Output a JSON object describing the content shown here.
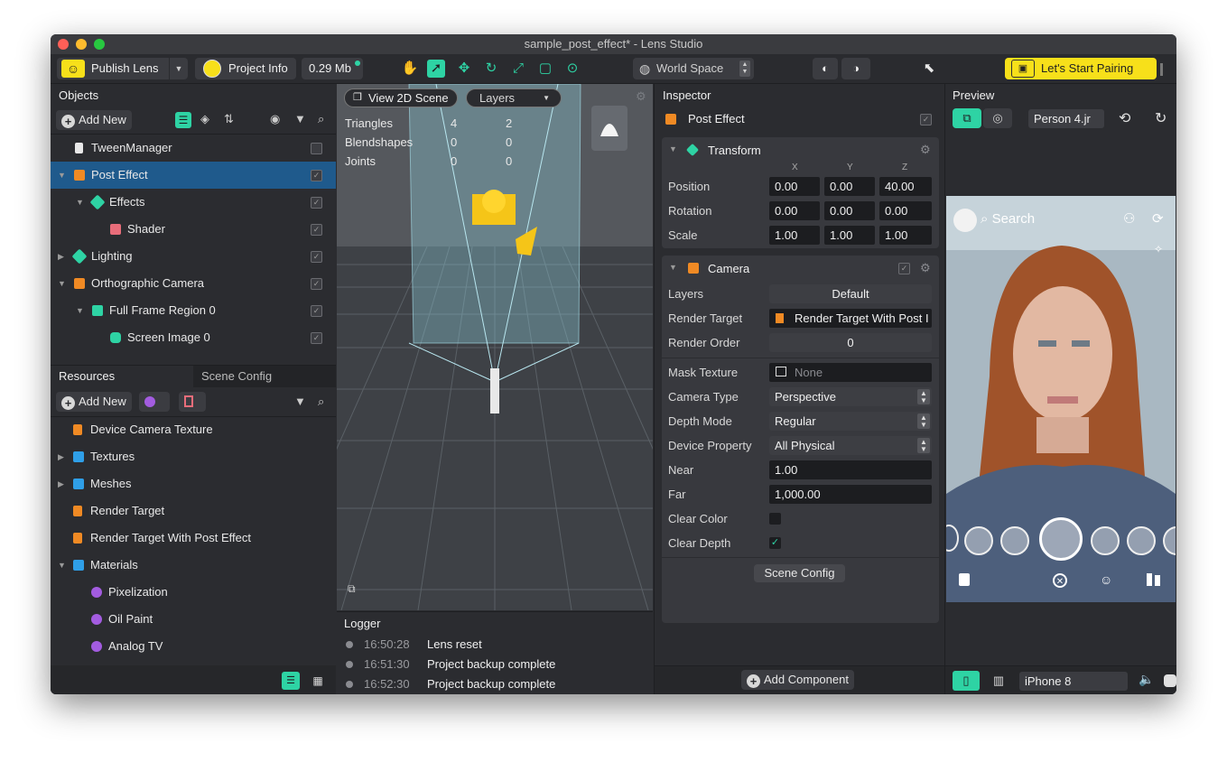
{
  "window": {
    "title": "sample_post_effect* - Lens Studio"
  },
  "toolbar": {
    "publish_label": "Publish Lens",
    "project_info_label": "Project Info",
    "size_label": "0.29 Mb",
    "space_label": "World Space",
    "pairing_label": "Let's Start Pairing"
  },
  "objects": {
    "title": "Objects",
    "add_new": "Add New",
    "items": [
      {
        "label": "TweenManager"
      },
      {
        "label": "Post Effect"
      },
      {
        "label": "Effects"
      },
      {
        "label": "Shader"
      },
      {
        "label": "Lighting"
      },
      {
        "label": "Orthographic Camera"
      },
      {
        "label": "Full Frame Region 0"
      },
      {
        "label": "Screen Image 0"
      }
    ]
  },
  "resources": {
    "tab_resources": "Resources",
    "tab_scene_config": "Scene Config",
    "add_new": "Add New",
    "items": [
      {
        "label": "Device Camera Texture"
      },
      {
        "label": "Textures"
      },
      {
        "label": "Meshes"
      },
      {
        "label": "Render Target"
      },
      {
        "label": "Render Target With Post Effect"
      },
      {
        "label": "Materials"
      },
      {
        "label": "Pixelization"
      },
      {
        "label": "Oil Paint"
      },
      {
        "label": "Analog TV"
      }
    ]
  },
  "scene": {
    "view_2d_label": "View 2D Scene",
    "layers_label": "Layers",
    "stats": [
      {
        "name": "Triangles",
        "a": "4",
        "b": "2"
      },
      {
        "name": "Blendshapes",
        "a": "0",
        "b": "0"
      },
      {
        "name": "Joints",
        "a": "0",
        "b": "0"
      }
    ]
  },
  "logger": {
    "title": "Logger",
    "entries": [
      {
        "time": "16:50:28",
        "message": "Lens reset"
      },
      {
        "time": "16:51:30",
        "message": "Project backup complete"
      },
      {
        "time": "16:52:30",
        "message": "Project backup complete"
      }
    ]
  },
  "inspector": {
    "title": "Inspector",
    "object_name": "Post Effect",
    "transform": {
      "title": "Transform",
      "axis_x": "X",
      "axis_y": "Y",
      "axis_z": "Z",
      "position_label": "Position",
      "position": [
        "0.00",
        "0.00",
        "40.00"
      ],
      "rotation_label": "Rotation",
      "rotation": [
        "0.00",
        "0.00",
        "0.00"
      ],
      "scale_label": "Scale",
      "scale": [
        "1.00",
        "1.00",
        "1.00"
      ]
    },
    "camera": {
      "title": "Camera",
      "layers_label": "Layers",
      "layers_value": "Default",
      "render_target_label": "Render Target",
      "render_target_value": "Render Target With Post I",
      "render_order_label": "Render Order",
      "render_order_value": "0",
      "mask_texture_label": "Mask Texture",
      "mask_texture_value": "None",
      "camera_type_label": "Camera Type",
      "camera_type_value": "Perspective",
      "depth_mode_label": "Depth Mode",
      "depth_mode_value": "Regular",
      "device_property_label": "Device Property",
      "device_property_value": "All Physical",
      "near_label": "Near",
      "near_value": "1.00",
      "far_label": "Far",
      "far_value": "1,000.00",
      "clear_color_label": "Clear Color",
      "clear_color_checked": false,
      "clear_depth_label": "Clear Depth",
      "clear_depth_checked": true,
      "scene_config_button": "Scene Config"
    },
    "add_component": "Add Component"
  },
  "preview": {
    "title": "Preview",
    "person_label": "Person 4.jr",
    "search_label": "Search",
    "device_label": "iPhone 8"
  },
  "colors": {
    "accent": "#2ed3a4",
    "selection": "#1f5a8c",
    "pairing_bg": "#f7e01a",
    "folder": "#2f9fe8",
    "camera_orange": "#f08a24"
  }
}
